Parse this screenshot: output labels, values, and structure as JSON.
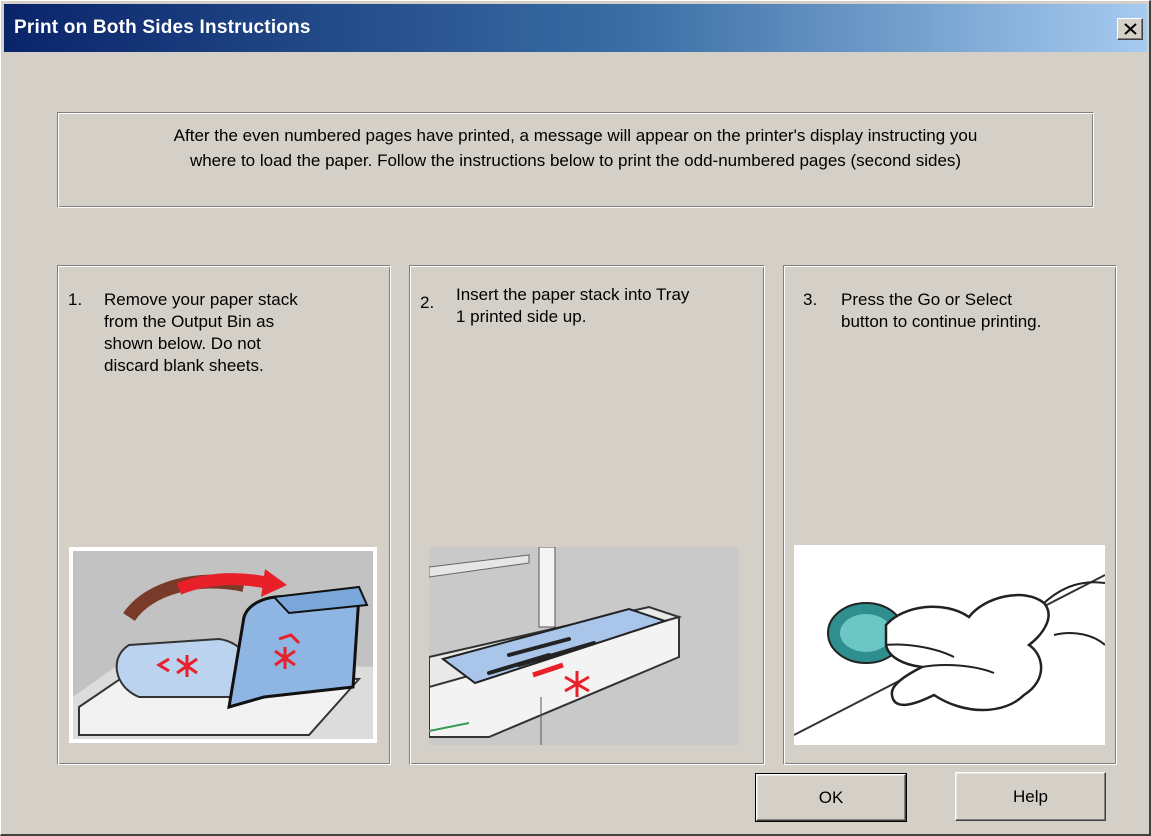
{
  "window": {
    "title": "Print on Both Sides Instructions"
  },
  "intro": {
    "line1": "After the even numbered pages have printed, a message will appear on the printer's display instructing you",
    "line2": "where to load the paper. Follow the instructions below to print the odd-numbered pages (second sides)"
  },
  "steps": [
    {
      "number": "1.",
      "lines": [
        "Remove your paper stack",
        "from the Output Bin as",
        "shown below.  Do not",
        "discard blank sheets."
      ],
      "illustration": "remove-paper-from-output-bin"
    },
    {
      "number": "2.",
      "lines": [
        "Insert the paper stack into Tray",
        "1 printed side up."
      ],
      "illustration": "insert-paper-into-tray-1"
    },
    {
      "number": "3.",
      "lines": [
        "Press the Go or Select",
        "button to continue printing."
      ],
      "illustration": "press-go-button"
    }
  ],
  "buttons": {
    "ok": "OK",
    "help": "Help"
  },
  "colors": {
    "dialog_face": "#d4d0c8",
    "title_gradient_start": "#0a246a",
    "title_gradient_end": "#a6caf0",
    "illustration_paper": "#bcd3f0",
    "illustration_marker": "#e8202a",
    "go_button": "#3fa9a8"
  }
}
